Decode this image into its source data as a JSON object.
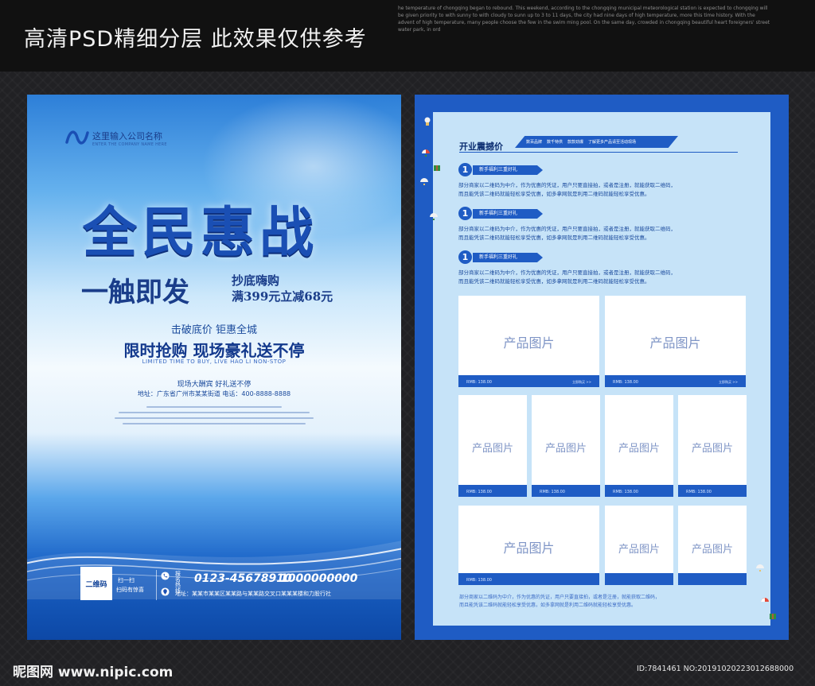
{
  "header": {
    "title": "高清PSD精细分层 此效果仅供参考",
    "blurb": "he temperature of chongqing began to rebound. This weekend, according to the chongqing municipal meteorological station is expected to chongqing will be given priority to with sunny to with cloudy to sunn up to 3 to 11 days, the city had nine days of high temperature, more this time history. With the advent of high temperature, many people choose the few in the swim ming pool. On the same day, crowded in chongqing beautiful heart foreigners' street water park, in ord"
  },
  "front": {
    "company_name": "这里输入公司名称",
    "company_en": "ENTER THE COMPANY NAME HERE",
    "headline": "全民惠战",
    "subhead": "一触即发",
    "promo_line1": "抄底嗨购",
    "promo_line2": "满399元立减68元",
    "strike": "击破底价 钜惠全城",
    "limited": "限时抢购 现场豪礼送不停",
    "limited_en": "LIMITED TIME TO BUY, LIVE HAO LI NON-STOP",
    "party": "现场大酬宾 好礼送不停",
    "address_line": "地址：广东省广州市某某街道 电话：400-8888-8888",
    "qr_label": "二维码",
    "scan1": "扫一扫",
    "scan2": "扫码有惊喜",
    "hotline_label": "报名热线",
    "hotline": "0123-45678910",
    "hotline2": "1000000000",
    "address_bottom": "地址：某某市某某区某某路与某某路交叉口某某某楼和力股行社"
  },
  "back": {
    "section_title": "开业震撼价",
    "ribbon_items": [
      "数百品牌",
      "数千特供",
      "款款劲爆",
      "了解更多产品请至活动现场"
    ],
    "benefits": [
      {
        "num": "1",
        "tag": "新手福利三重好礼",
        "line1": "部分商家以二维码为中介，作为优惠的凭证，用户只要直接拍，或者是注册，就能获取二维码，",
        "line2": "而且能凭该二维码就能轻松享受优惠，如多拿网就是利用二维码就能轻松享受优惠。"
      },
      {
        "num": "1",
        "tag": "新手福利三重好礼",
        "line1": "部分商家以二维码为中介，作为优惠的凭证，用户只要直接拍，或者是注册，就能获取二维码，",
        "line2": "而且能凭该二维码就能轻松享受优惠，如多拿网就是利用二维码就能轻松享受优惠。"
      },
      {
        "num": "1",
        "tag": "新手福利三重好礼",
        "line1": "部分商家以二维码为中介，作为优惠的凭证，用户只要直接拍，或者是注册，就能获取二维码，",
        "line2": "而且能凭该二维码就能轻松享受优惠，如多拿网就是利用二维码就能轻松享受优惠。"
      }
    ],
    "product_label": "产品图片",
    "price": "RMB: 138.00",
    "buy": "立即购买 >>",
    "footer_line1": "部分商家以二维码为中介，作为优惠的凭证，用户只要直接拍，或者是注册，就能获取二维码，",
    "footer_line2": "而且能凭该二维码就能轻松享受优惠，如多拿网就是利用二维码就能轻松享受优惠。"
  },
  "watermark": {
    "left": "昵图网 www.nipic.com",
    "right": "ID:7841461 NO:20191020223012688000"
  },
  "colors": {
    "brand_blue": "#1f5cc4",
    "panel_light": "#c6e3f8",
    "headline_blue": "#1a4fb4"
  }
}
